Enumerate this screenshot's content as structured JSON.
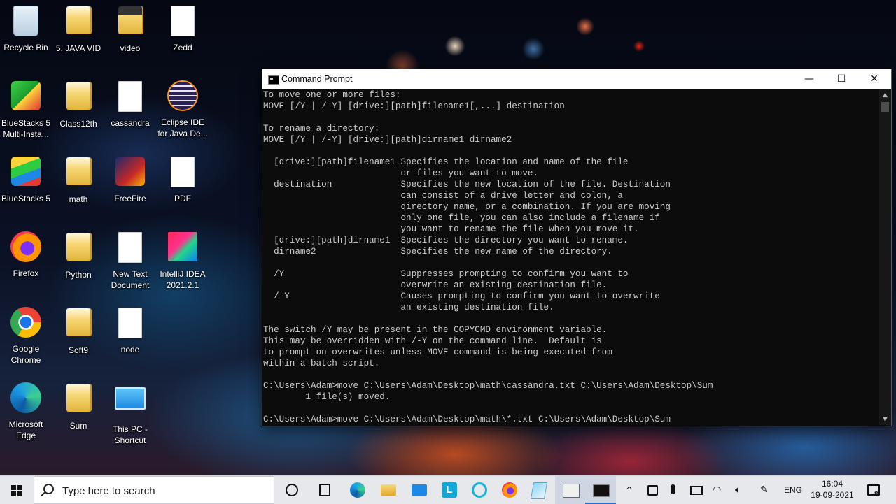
{
  "desktop": {
    "icons": [
      {
        "label": "Recycle Bin"
      },
      {
        "label": "5. JAVA VID"
      },
      {
        "label": "video"
      },
      {
        "label": "Zedd"
      },
      {
        "label": "BlueStacks 5 Multi-Insta..."
      },
      {
        "label": "Class12th"
      },
      {
        "label": "cassandra"
      },
      {
        "label": "Eclipse IDE for Java De..."
      },
      {
        "label": "BlueStacks 5"
      },
      {
        "label": "math"
      },
      {
        "label": "FreeFire"
      },
      {
        "label": "PDF"
      },
      {
        "label": "Firefox"
      },
      {
        "label": "Python"
      },
      {
        "label": "New Text Document"
      },
      {
        "label": "IntelliJ IDEA 2021.2.1"
      },
      {
        "label": "Google Chrome"
      },
      {
        "label": "Soft9"
      },
      {
        "label": "node"
      },
      {
        "label": "Microsoft Edge"
      },
      {
        "label": "Sum"
      },
      {
        "label": "This PC - Shortcut"
      }
    ]
  },
  "cmd": {
    "title": "Command Prompt",
    "minimize": "—",
    "maximize": "☐",
    "close": "✕",
    "lines": [
      "To move one or more files:",
      "MOVE [/Y | /-Y] [drive:][path]filename1[,...] destination",
      "",
      "To rename a directory:",
      "MOVE [/Y | /-Y] [drive:][path]dirname1 dirname2",
      "",
      "  [drive:][path]filename1 Specifies the location and name of the file",
      "                          or files you want to move.",
      "  destination             Specifies the new location of the file. Destination",
      "                          can consist of a drive letter and colon, a",
      "                          directory name, or a combination. If you are moving",
      "                          only one file, you can also include a filename if",
      "                          you want to rename the file when you move it.",
      "  [drive:][path]dirname1  Specifies the directory you want to rename.",
      "  dirname2                Specifies the new name of the directory.",
      "",
      "  /Y                      Suppresses prompting to confirm you want to",
      "                          overwrite an existing destination file.",
      "  /-Y                     Causes prompting to confirm you want to overwrite",
      "                          an existing destination file.",
      "",
      "The switch /Y may be present in the COPYCMD environment variable.",
      "This may be overridden with /-Y on the command line.  Default is",
      "to prompt on overwrites unless MOVE command is being executed from",
      "within a batch script.",
      "",
      "C:\\Users\\Adam>move C:\\Users\\Adam\\Desktop\\math\\cassandra.txt C:\\Users\\Adam\\Desktop\\Sum",
      "        1 file(s) moved.",
      ""
    ],
    "current_command": "C:\\Users\\Adam>move C:\\Users\\Adam\\Desktop\\math\\*.txt C:\\Users\\Adam\\Desktop\\Sum"
  },
  "taskbar": {
    "search_placeholder": "Type here to search",
    "language": "ENG",
    "time": "16:04",
    "date": "19-09-2021",
    "notification_count": "8"
  }
}
